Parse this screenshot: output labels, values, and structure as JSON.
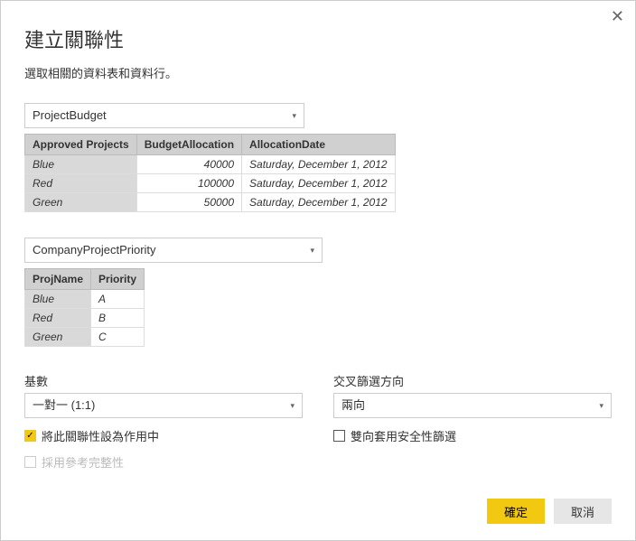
{
  "dialog": {
    "title": "建立關聯性",
    "subtitle": "選取相關的資料表和資料行。",
    "close_glyph": "✕"
  },
  "table1": {
    "selected": "ProjectBudget",
    "headers": [
      "Approved Projects",
      "BudgetAllocation",
      "AllocationDate"
    ],
    "rows": [
      {
        "c0": "Blue",
        "c1": "40000",
        "c2": "Saturday, December 1, 2012"
      },
      {
        "c0": "Red",
        "c1": "100000",
        "c2": "Saturday, December 1, 2012"
      },
      {
        "c0": "Green",
        "c1": "50000",
        "c2": "Saturday, December 1, 2012"
      }
    ]
  },
  "table2": {
    "selected": "CompanyProjectPriority",
    "headers": [
      "ProjName",
      "Priority"
    ],
    "rows": [
      {
        "c0": "Blue",
        "c1": "A"
      },
      {
        "c0": "Red",
        "c1": "B"
      },
      {
        "c0": "Green",
        "c1": "C"
      }
    ]
  },
  "options": {
    "cardinality_label": "基數",
    "cardinality_value": "一對一 (1:1)",
    "crossfilter_label": "交叉篩選方向",
    "crossfilter_value": "兩向",
    "active_label": "將此關聯性設為作用中",
    "security_label": "雙向套用安全性篩選",
    "referential_label": "採用參考完整性"
  },
  "buttons": {
    "ok": "確定",
    "cancel": "取消"
  },
  "glyphs": {
    "caret": "▾",
    "check": "✓"
  }
}
